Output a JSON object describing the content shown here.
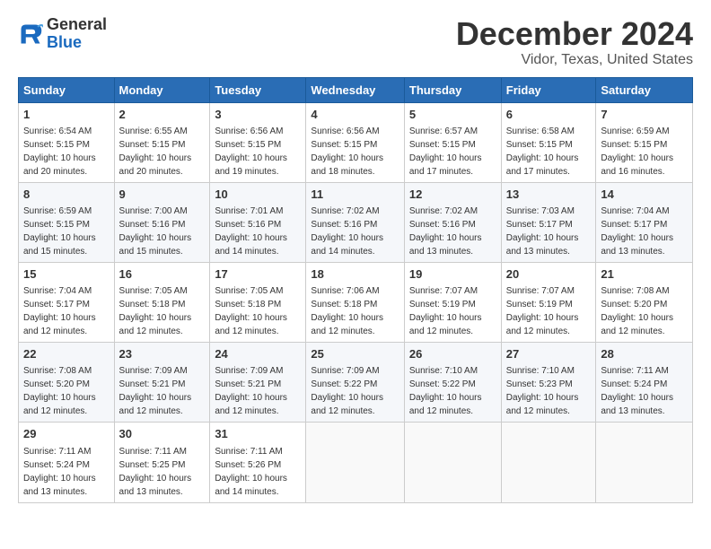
{
  "logo": {
    "line1": "General",
    "line2": "Blue"
  },
  "title": "December 2024",
  "location": "Vidor, Texas, United States",
  "headers": [
    "Sunday",
    "Monday",
    "Tuesday",
    "Wednesday",
    "Thursday",
    "Friday",
    "Saturday"
  ],
  "weeks": [
    [
      {
        "day": "1",
        "sunrise": "6:54 AM",
        "sunset": "5:15 PM",
        "daylight": "10 hours and 20 minutes."
      },
      {
        "day": "2",
        "sunrise": "6:55 AM",
        "sunset": "5:15 PM",
        "daylight": "10 hours and 20 minutes."
      },
      {
        "day": "3",
        "sunrise": "6:56 AM",
        "sunset": "5:15 PM",
        "daylight": "10 hours and 19 minutes."
      },
      {
        "day": "4",
        "sunrise": "6:56 AM",
        "sunset": "5:15 PM",
        "daylight": "10 hours and 18 minutes."
      },
      {
        "day": "5",
        "sunrise": "6:57 AM",
        "sunset": "5:15 PM",
        "daylight": "10 hours and 17 minutes."
      },
      {
        "day": "6",
        "sunrise": "6:58 AM",
        "sunset": "5:15 PM",
        "daylight": "10 hours and 17 minutes."
      },
      {
        "day": "7",
        "sunrise": "6:59 AM",
        "sunset": "5:15 PM",
        "daylight": "10 hours and 16 minutes."
      }
    ],
    [
      {
        "day": "8",
        "sunrise": "6:59 AM",
        "sunset": "5:15 PM",
        "daylight": "10 hours and 15 minutes."
      },
      {
        "day": "9",
        "sunrise": "7:00 AM",
        "sunset": "5:16 PM",
        "daylight": "10 hours and 15 minutes."
      },
      {
        "day": "10",
        "sunrise": "7:01 AM",
        "sunset": "5:16 PM",
        "daylight": "10 hours and 14 minutes."
      },
      {
        "day": "11",
        "sunrise": "7:02 AM",
        "sunset": "5:16 PM",
        "daylight": "10 hours and 14 minutes."
      },
      {
        "day": "12",
        "sunrise": "7:02 AM",
        "sunset": "5:16 PM",
        "daylight": "10 hours and 13 minutes."
      },
      {
        "day": "13",
        "sunrise": "7:03 AM",
        "sunset": "5:17 PM",
        "daylight": "10 hours and 13 minutes."
      },
      {
        "day": "14",
        "sunrise": "7:04 AM",
        "sunset": "5:17 PM",
        "daylight": "10 hours and 13 minutes."
      }
    ],
    [
      {
        "day": "15",
        "sunrise": "7:04 AM",
        "sunset": "5:17 PM",
        "daylight": "10 hours and 12 minutes."
      },
      {
        "day": "16",
        "sunrise": "7:05 AM",
        "sunset": "5:18 PM",
        "daylight": "10 hours and 12 minutes."
      },
      {
        "day": "17",
        "sunrise": "7:05 AM",
        "sunset": "5:18 PM",
        "daylight": "10 hours and 12 minutes."
      },
      {
        "day": "18",
        "sunrise": "7:06 AM",
        "sunset": "5:18 PM",
        "daylight": "10 hours and 12 minutes."
      },
      {
        "day": "19",
        "sunrise": "7:07 AM",
        "sunset": "5:19 PM",
        "daylight": "10 hours and 12 minutes."
      },
      {
        "day": "20",
        "sunrise": "7:07 AM",
        "sunset": "5:19 PM",
        "daylight": "10 hours and 12 minutes."
      },
      {
        "day": "21",
        "sunrise": "7:08 AM",
        "sunset": "5:20 PM",
        "daylight": "10 hours and 12 minutes."
      }
    ],
    [
      {
        "day": "22",
        "sunrise": "7:08 AM",
        "sunset": "5:20 PM",
        "daylight": "10 hours and 12 minutes."
      },
      {
        "day": "23",
        "sunrise": "7:09 AM",
        "sunset": "5:21 PM",
        "daylight": "10 hours and 12 minutes."
      },
      {
        "day": "24",
        "sunrise": "7:09 AM",
        "sunset": "5:21 PM",
        "daylight": "10 hours and 12 minutes."
      },
      {
        "day": "25",
        "sunrise": "7:09 AM",
        "sunset": "5:22 PM",
        "daylight": "10 hours and 12 minutes."
      },
      {
        "day": "26",
        "sunrise": "7:10 AM",
        "sunset": "5:22 PM",
        "daylight": "10 hours and 12 minutes."
      },
      {
        "day": "27",
        "sunrise": "7:10 AM",
        "sunset": "5:23 PM",
        "daylight": "10 hours and 12 minutes."
      },
      {
        "day": "28",
        "sunrise": "7:11 AM",
        "sunset": "5:24 PM",
        "daylight": "10 hours and 13 minutes."
      }
    ],
    [
      {
        "day": "29",
        "sunrise": "7:11 AM",
        "sunset": "5:24 PM",
        "daylight": "10 hours and 13 minutes."
      },
      {
        "day": "30",
        "sunrise": "7:11 AM",
        "sunset": "5:25 PM",
        "daylight": "10 hours and 13 minutes."
      },
      {
        "day": "31",
        "sunrise": "7:11 AM",
        "sunset": "5:26 PM",
        "daylight": "10 hours and 14 minutes."
      },
      null,
      null,
      null,
      null
    ]
  ]
}
